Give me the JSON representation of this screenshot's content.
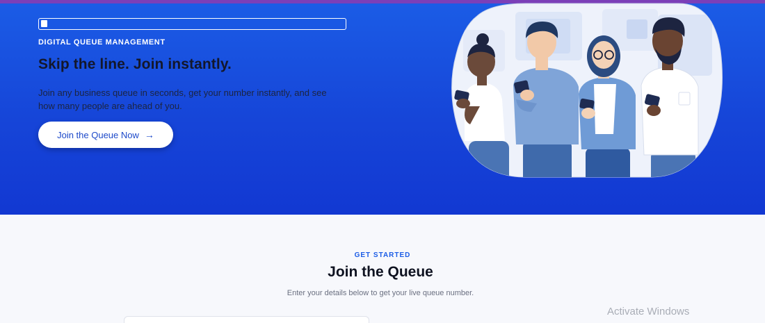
{
  "hero": {
    "progress": 0.02,
    "eyebrow": "DIGITAL QUEUE MANAGEMENT",
    "title": "Skip the line. Join instantly.",
    "description": "Join any business queue in seconds, get your number instantly, and see how many people are ahead of you.",
    "cta_label": "Join the Queue Now",
    "cta_icon": "arrow-right-icon",
    "illustration": "people-with-phones-illustration"
  },
  "section": {
    "eyebrow": "GET STARTED",
    "title": "Join the Queue",
    "subtitle": "Enter your details below to get your live queue number."
  },
  "system": {
    "watermark": "Activate Windows"
  },
  "colors": {
    "accent": "#1b5ce6",
    "hero_bg": "#1645d8",
    "top_stripe": "#7b3fb8"
  }
}
